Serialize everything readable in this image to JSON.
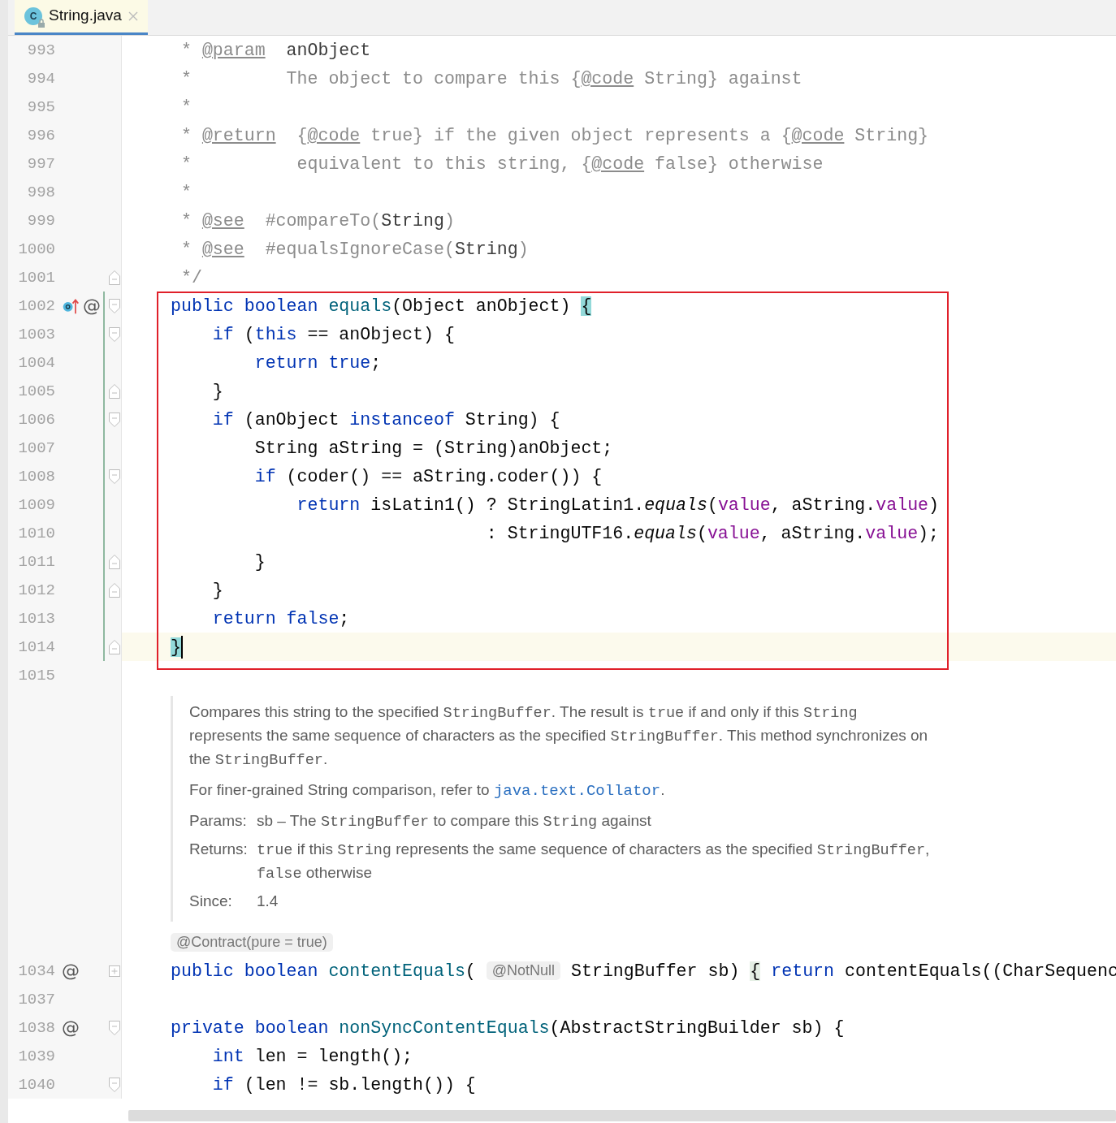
{
  "tab": {
    "label": "String.java",
    "icon_letter": "C",
    "selected": true
  },
  "sections": [
    {
      "kind": "code",
      "lines": [
        {
          "number": "993",
          "tokens": [
            {
              "kind": "c",
              "t": " * "
            },
            {
              "kind": "tag",
              "t": "@param"
            },
            {
              "kind": "dr",
              "t": "  anObject"
            }
          ]
        },
        {
          "number": "994",
          "tokens": [
            {
              "kind": "c",
              "t": " *         The object to compare this {"
            },
            {
              "kind": "tag",
              "t": "@code"
            },
            {
              "kind": "c",
              "t": " String} against"
            }
          ]
        },
        {
          "number": "995",
          "tokens": [
            {
              "kind": "c",
              "t": " *"
            }
          ]
        },
        {
          "number": "996",
          "tokens": [
            {
              "kind": "c",
              "t": " * "
            },
            {
              "kind": "tag",
              "t": "@return"
            },
            {
              "kind": "c",
              "t": "  {"
            },
            {
              "kind": "tag",
              "t": "@code"
            },
            {
              "kind": "c",
              "t": " true} if the given object represents a {"
            },
            {
              "kind": "tag",
              "t": "@code"
            },
            {
              "kind": "c",
              "t": " String}"
            }
          ]
        },
        {
          "number": "997",
          "tokens": [
            {
              "kind": "c",
              "t": " *          equivalent to this string, {"
            },
            {
              "kind": "tag",
              "t": "@code"
            },
            {
              "kind": "c",
              "t": " false} otherwise"
            }
          ]
        },
        {
          "number": "998",
          "tokens": [
            {
              "kind": "c",
              "t": " *"
            }
          ]
        },
        {
          "number": "999",
          "tokens": [
            {
              "kind": "c",
              "t": " * "
            },
            {
              "kind": "tag",
              "t": "@see"
            },
            {
              "kind": "c",
              "t": "  #compareTo("
            },
            {
              "kind": "dr",
              "t": "String"
            },
            {
              "kind": "c",
              "t": ")"
            }
          ]
        },
        {
          "number": "1000",
          "tokens": [
            {
              "kind": "c",
              "t": " * "
            },
            {
              "kind": "tag",
              "t": "@see"
            },
            {
              "kind": "c",
              "t": "  #equalsIgnoreCase("
            },
            {
              "kind": "dr",
              "t": "String"
            },
            {
              "kind": "c",
              "t": ")"
            }
          ]
        },
        {
          "number": "1001",
          "fold": {
            "kind": "end"
          },
          "tokens": [
            {
              "kind": "c",
              "t": " */"
            }
          ]
        }
      ]
    },
    {
      "kind": "code",
      "boxed": true,
      "lines": [
        {
          "number": "1002",
          "fold": {
            "kind": "start"
          },
          "modified": true,
          "gutter": [
            {
              "kind": "overrides"
            },
            {
              "kind": "text",
              "text": "@"
            }
          ],
          "tokens": [
            {
              "kind": "kw",
              "t": "public boolean "
            },
            {
              "kind": "fn",
              "t": "equals"
            },
            {
              "kind": "p",
              "t": "(Object anObject) "
            },
            {
              "kind": "bm",
              "t": "{"
            }
          ]
        },
        {
          "number": "1003",
          "fold": {
            "kind": "start"
          },
          "modified": true,
          "tokens": [
            {
              "kind": "kw",
              "t": "    if "
            },
            {
              "kind": "p",
              "t": "("
            },
            {
              "kind": "kw",
              "t": "this"
            },
            {
              "kind": "p",
              "t": " == anObject) {"
            }
          ]
        },
        {
          "number": "1004",
          "modified": true,
          "tokens": [
            {
              "kind": "kw",
              "t": "        return true"
            },
            {
              "kind": "p",
              "t": ";"
            }
          ]
        },
        {
          "number": "1005",
          "fold": {
            "kind": "end"
          },
          "modified": true,
          "tokens": [
            {
              "kind": "p",
              "t": "    }"
            }
          ]
        },
        {
          "number": "1006",
          "fold": {
            "kind": "start"
          },
          "modified": true,
          "tokens": [
            {
              "kind": "kw",
              "t": "    if "
            },
            {
              "kind": "p",
              "t": "(anObject "
            },
            {
              "kind": "kw",
              "t": "instanceof"
            },
            {
              "kind": "p",
              "t": " String) {"
            }
          ]
        },
        {
          "number": "1007",
          "modified": true,
          "tokens": [
            {
              "kind": "p",
              "t": "        String aString = (String)anObject;"
            }
          ]
        },
        {
          "number": "1008",
          "fold": {
            "kind": "start"
          },
          "modified": true,
          "tokens": [
            {
              "kind": "kw",
              "t": "        if"
            },
            {
              "kind": "p",
              "t": " (coder() == aString.coder()) {"
            }
          ]
        },
        {
          "number": "1009",
          "modified": true,
          "tokens": [
            {
              "kind": "kw",
              "t": "            return"
            },
            {
              "kind": "p",
              "t": " isLatin1() ? StringLatin1."
            },
            {
              "kind": "it",
              "t": "equals"
            },
            {
              "kind": "p",
              "t": "("
            },
            {
              "kind": "fld",
              "t": "value"
            },
            {
              "kind": "p",
              "t": ", aString."
            },
            {
              "kind": "fld",
              "t": "value"
            },
            {
              "kind": "p",
              "t": ")"
            }
          ]
        },
        {
          "number": "1010",
          "modified": true,
          "tokens": [
            {
              "kind": "p",
              "t": "                              : StringUTF16."
            },
            {
              "kind": "it",
              "t": "equals"
            },
            {
              "kind": "p",
              "t": "("
            },
            {
              "kind": "fld",
              "t": "value"
            },
            {
              "kind": "p",
              "t": ", aString."
            },
            {
              "kind": "fld",
              "t": "value"
            },
            {
              "kind": "p",
              "t": ");"
            }
          ]
        },
        {
          "number": "1011",
          "fold": {
            "kind": "end"
          },
          "modified": true,
          "tokens": [
            {
              "kind": "p",
              "t": "        }"
            }
          ]
        },
        {
          "number": "1012",
          "fold": {
            "kind": "end"
          },
          "modified": true,
          "tokens": [
            {
              "kind": "p",
              "t": "    }"
            }
          ]
        },
        {
          "number": "1013",
          "modified": true,
          "tokens": [
            {
              "kind": "kw",
              "t": "    return false"
            },
            {
              "kind": "p",
              "t": ";"
            }
          ]
        },
        {
          "number": "1014",
          "fold": {
            "kind": "end"
          },
          "modified": true,
          "current": true,
          "tokens": [
            {
              "kind": "bm",
              "t": "}"
            }
          ]
        }
      ]
    },
    {
      "kind": "code",
      "lines": [
        {
          "number": "1015"
        }
      ]
    },
    {
      "kind": "doc",
      "paragraphs": [
        [
          {
            "kind": "text",
            "t": "Compares this string to the specified "
          },
          {
            "kind": "mono",
            "t": "StringBuffer"
          },
          {
            "kind": "text",
            "t": ". The result is "
          },
          {
            "kind": "mono",
            "t": "true"
          },
          {
            "kind": "text",
            "t": " if and only if this "
          },
          {
            "kind": "mono",
            "t": "String"
          },
          {
            "kind": "text",
            "t": " represents the same sequence of characters as the specified "
          },
          {
            "kind": "mono",
            "t": "StringBuffer"
          },
          {
            "kind": "text",
            "t": ". This method synchronizes on the "
          },
          {
            "kind": "mono",
            "t": "StringBuffer"
          },
          {
            "kind": "text",
            "t": "."
          }
        ],
        [
          {
            "kind": "text",
            "t": "For finer-grained String comparison, refer to "
          },
          {
            "kind": "link",
            "t": "java.text.Collator"
          },
          {
            "kind": "text",
            "t": "."
          }
        ]
      ],
      "defs": [
        {
          "label": "Params:",
          "value": [
            {
              "kind": "text",
              "t": "sb – The "
            },
            {
              "kind": "mono",
              "t": "StringBuffer"
            },
            {
              "kind": "text",
              "t": " to compare this "
            },
            {
              "kind": "mono",
              "t": "String"
            },
            {
              "kind": "text",
              "t": " against"
            }
          ]
        },
        {
          "label": "Returns:",
          "value": [
            {
              "kind": "mono",
              "t": "true"
            },
            {
              "kind": "text",
              "t": " if this "
            },
            {
              "kind": "mono",
              "t": "String"
            },
            {
              "kind": "text",
              "t": " represents the same sequence of characters as the specified "
            },
            {
              "kind": "mono",
              "t": "StringBuffer"
            },
            {
              "kind": "text",
              "t": ", "
            },
            {
              "kind": "mono",
              "t": "false"
            },
            {
              "kind": "text",
              "t": " otherwise"
            }
          ]
        },
        {
          "label": "Since:",
          "value": [
            {
              "kind": "text",
              "t": "1.4"
            }
          ]
        }
      ]
    },
    {
      "kind": "code",
      "lines": [
        {
          "tokens": [
            {
              "kind": "inl",
              "t": "@Contract(pure = true)"
            }
          ]
        },
        {
          "number": "1034",
          "fold": {
            "kind": "collapsed"
          },
          "gutter": [
            {
              "kind": "text",
              "text": "@"
            }
          ],
          "tokens": [
            {
              "kind": "kw",
              "t": "public boolean "
            },
            {
              "kind": "fn",
              "t": "contentEquals"
            },
            {
              "kind": "p",
              "t": "( "
            },
            {
              "kind": "inl",
              "t": "@NotNull"
            },
            {
              "kind": "p",
              "t": " StringBuffer sb) "
            },
            {
              "kind": "fold",
              "t": "{"
            },
            {
              "kind": "kw",
              "t": " return"
            },
            {
              "kind": "p",
              "t": " contentEquals((CharSequenc"
            }
          ]
        },
        {
          "number": "1037"
        },
        {
          "number": "1038",
          "fold": {
            "kind": "start"
          },
          "gutter": [
            {
              "kind": "text",
              "text": "@"
            }
          ],
          "tokens": [
            {
              "kind": "kw",
              "t": "private boolean "
            },
            {
              "kind": "fn",
              "t": "nonSyncContentEquals"
            },
            {
              "kind": "p",
              "t": "(AbstractStringBuilder sb) {"
            }
          ]
        },
        {
          "number": "1039",
          "tokens": [
            {
              "kind": "kw",
              "t": "    int"
            },
            {
              "kind": "p",
              "t": " len = length();"
            }
          ]
        },
        {
          "number": "1040",
          "fold": {
            "kind": "start"
          },
          "tokens": [
            {
              "kind": "kw",
              "t": "    if"
            },
            {
              "kind": "p",
              "t": " (len != sb.length()) {"
            }
          ]
        }
      ]
    }
  ]
}
